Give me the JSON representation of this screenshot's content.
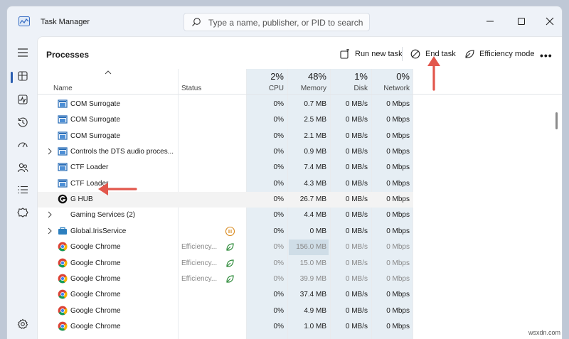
{
  "window": {
    "title": "Task Manager",
    "search_placeholder": "Type a name, publisher, or PID to search"
  },
  "page": {
    "title": "Processes",
    "run_new_task": "Run new task",
    "end_task": "End task",
    "efficiency_mode": "Efficiency mode",
    "more": "•••"
  },
  "columns": {
    "name": "Name",
    "status": "Status",
    "cpu_pct": "2%",
    "cpu": "CPU",
    "memory_pct": "48%",
    "memory": "Memory",
    "disk_pct": "1%",
    "disk": "Disk",
    "network_pct": "0%",
    "network": "Network"
  },
  "rows": [
    {
      "name": "COM Surrogate",
      "status": "",
      "cpu": "0%",
      "memory": "0.7 MB",
      "disk": "0 MB/s",
      "network": "0 Mbps",
      "icon": "window-icon",
      "expand": false
    },
    {
      "name": "COM Surrogate",
      "status": "",
      "cpu": "0%",
      "memory": "2.5 MB",
      "disk": "0 MB/s",
      "network": "0 Mbps",
      "icon": "window-icon",
      "expand": false
    },
    {
      "name": "COM Surrogate",
      "status": "",
      "cpu": "0%",
      "memory": "2.1 MB",
      "disk": "0 MB/s",
      "network": "0 Mbps",
      "icon": "window-icon",
      "expand": false
    },
    {
      "name": "Controls the DTS audio proces...",
      "status": "",
      "cpu": "0%",
      "memory": "0.9 MB",
      "disk": "0 MB/s",
      "network": "0 Mbps",
      "icon": "window-icon",
      "expand": true
    },
    {
      "name": "CTF Loader",
      "status": "",
      "cpu": "0%",
      "memory": "7.4 MB",
      "disk": "0 MB/s",
      "network": "0 Mbps",
      "icon": "window-icon",
      "expand": false
    },
    {
      "name": "CTF Loader",
      "status": "",
      "cpu": "0%",
      "memory": "4.3 MB",
      "disk": "0 MB/s",
      "network": "0 Mbps",
      "icon": "window-icon",
      "expand": false
    },
    {
      "name": "G HUB",
      "status": "",
      "cpu": "0%",
      "memory": "26.7 MB",
      "disk": "0 MB/s",
      "network": "0 Mbps",
      "icon": "ghub-icon",
      "expand": false,
      "selected": true
    },
    {
      "name": "Gaming Services (2)",
      "status": "",
      "cpu": "0%",
      "memory": "4.4 MB",
      "disk": "0 MB/s",
      "network": "0 Mbps",
      "icon": "none",
      "expand": true
    },
    {
      "name": "Global.IrisService",
      "status": "",
      "cpu": "0%",
      "memory": "0 MB",
      "disk": "0 MB/s",
      "network": "0 Mbps",
      "icon": "iris-icon",
      "expand": true,
      "status_icon": "paused-icon"
    },
    {
      "name": "Google Chrome",
      "status": "Efficiency...",
      "cpu": "0%",
      "memory": "156.0 MB",
      "disk": "0 MB/s",
      "network": "0 Mbps",
      "icon": "chrome-icon",
      "expand": false,
      "status_icon": "leaf-icon",
      "dim": true,
      "mem_highlight": true
    },
    {
      "name": "Google Chrome",
      "status": "Efficiency...",
      "cpu": "0%",
      "memory": "15.0 MB",
      "disk": "0 MB/s",
      "network": "0 Mbps",
      "icon": "chrome-icon",
      "expand": false,
      "status_icon": "leaf-icon",
      "dim": true
    },
    {
      "name": "Google Chrome",
      "status": "Efficiency...",
      "cpu": "0%",
      "memory": "39.9 MB",
      "disk": "0 MB/s",
      "network": "0 Mbps",
      "icon": "chrome-icon",
      "expand": false,
      "status_icon": "leaf-icon",
      "dim": true
    },
    {
      "name": "Google Chrome",
      "status": "",
      "cpu": "0%",
      "memory": "37.4 MB",
      "disk": "0 MB/s",
      "network": "0 Mbps",
      "icon": "chrome-icon",
      "expand": false
    },
    {
      "name": "Google Chrome",
      "status": "",
      "cpu": "0%",
      "memory": "4.9 MB",
      "disk": "0 MB/s",
      "network": "0 Mbps",
      "icon": "chrome-icon",
      "expand": false
    },
    {
      "name": "Google Chrome",
      "status": "",
      "cpu": "0%",
      "memory": "1.0 MB",
      "disk": "0 MB/s",
      "network": "0 Mbps",
      "icon": "chrome-icon",
      "expand": false
    }
  ],
  "watermark": "wsxdn.com",
  "colors": {
    "accent": "#2a5db0",
    "annotation_arrow": "#e2574c",
    "column_highlight": "#e6eef4"
  }
}
